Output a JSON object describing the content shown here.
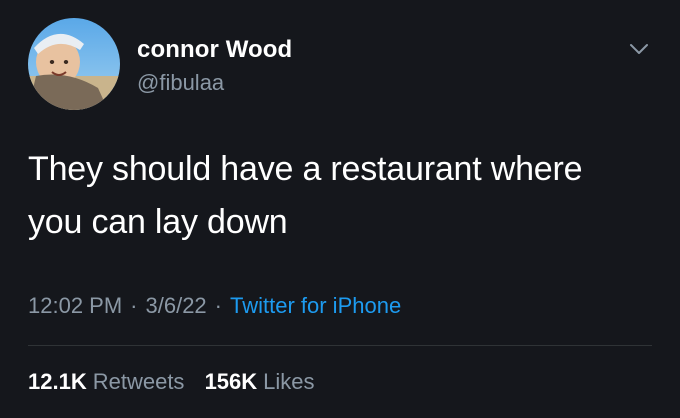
{
  "author": {
    "display_name": "connor Wood",
    "handle": "@fibulaa"
  },
  "tweet": {
    "line1": "They should have a restaurant where",
    "line2": "you can lay down"
  },
  "meta": {
    "time": "12:02 PM",
    "date": "3/6/22",
    "source": "Twitter for iPhone",
    "separator": "·"
  },
  "stats": {
    "retweets_count": "12.1K",
    "retweets_label": "Retweets",
    "likes_count": "156K",
    "likes_label": "Likes"
  },
  "icons": {
    "more_menu": "chevron-down-icon"
  },
  "colors": {
    "background": "#15171c",
    "primary_text": "#ffffff",
    "secondary_text": "#8b98a5",
    "link": "#1d9bf0",
    "divider": "#2f3336"
  }
}
